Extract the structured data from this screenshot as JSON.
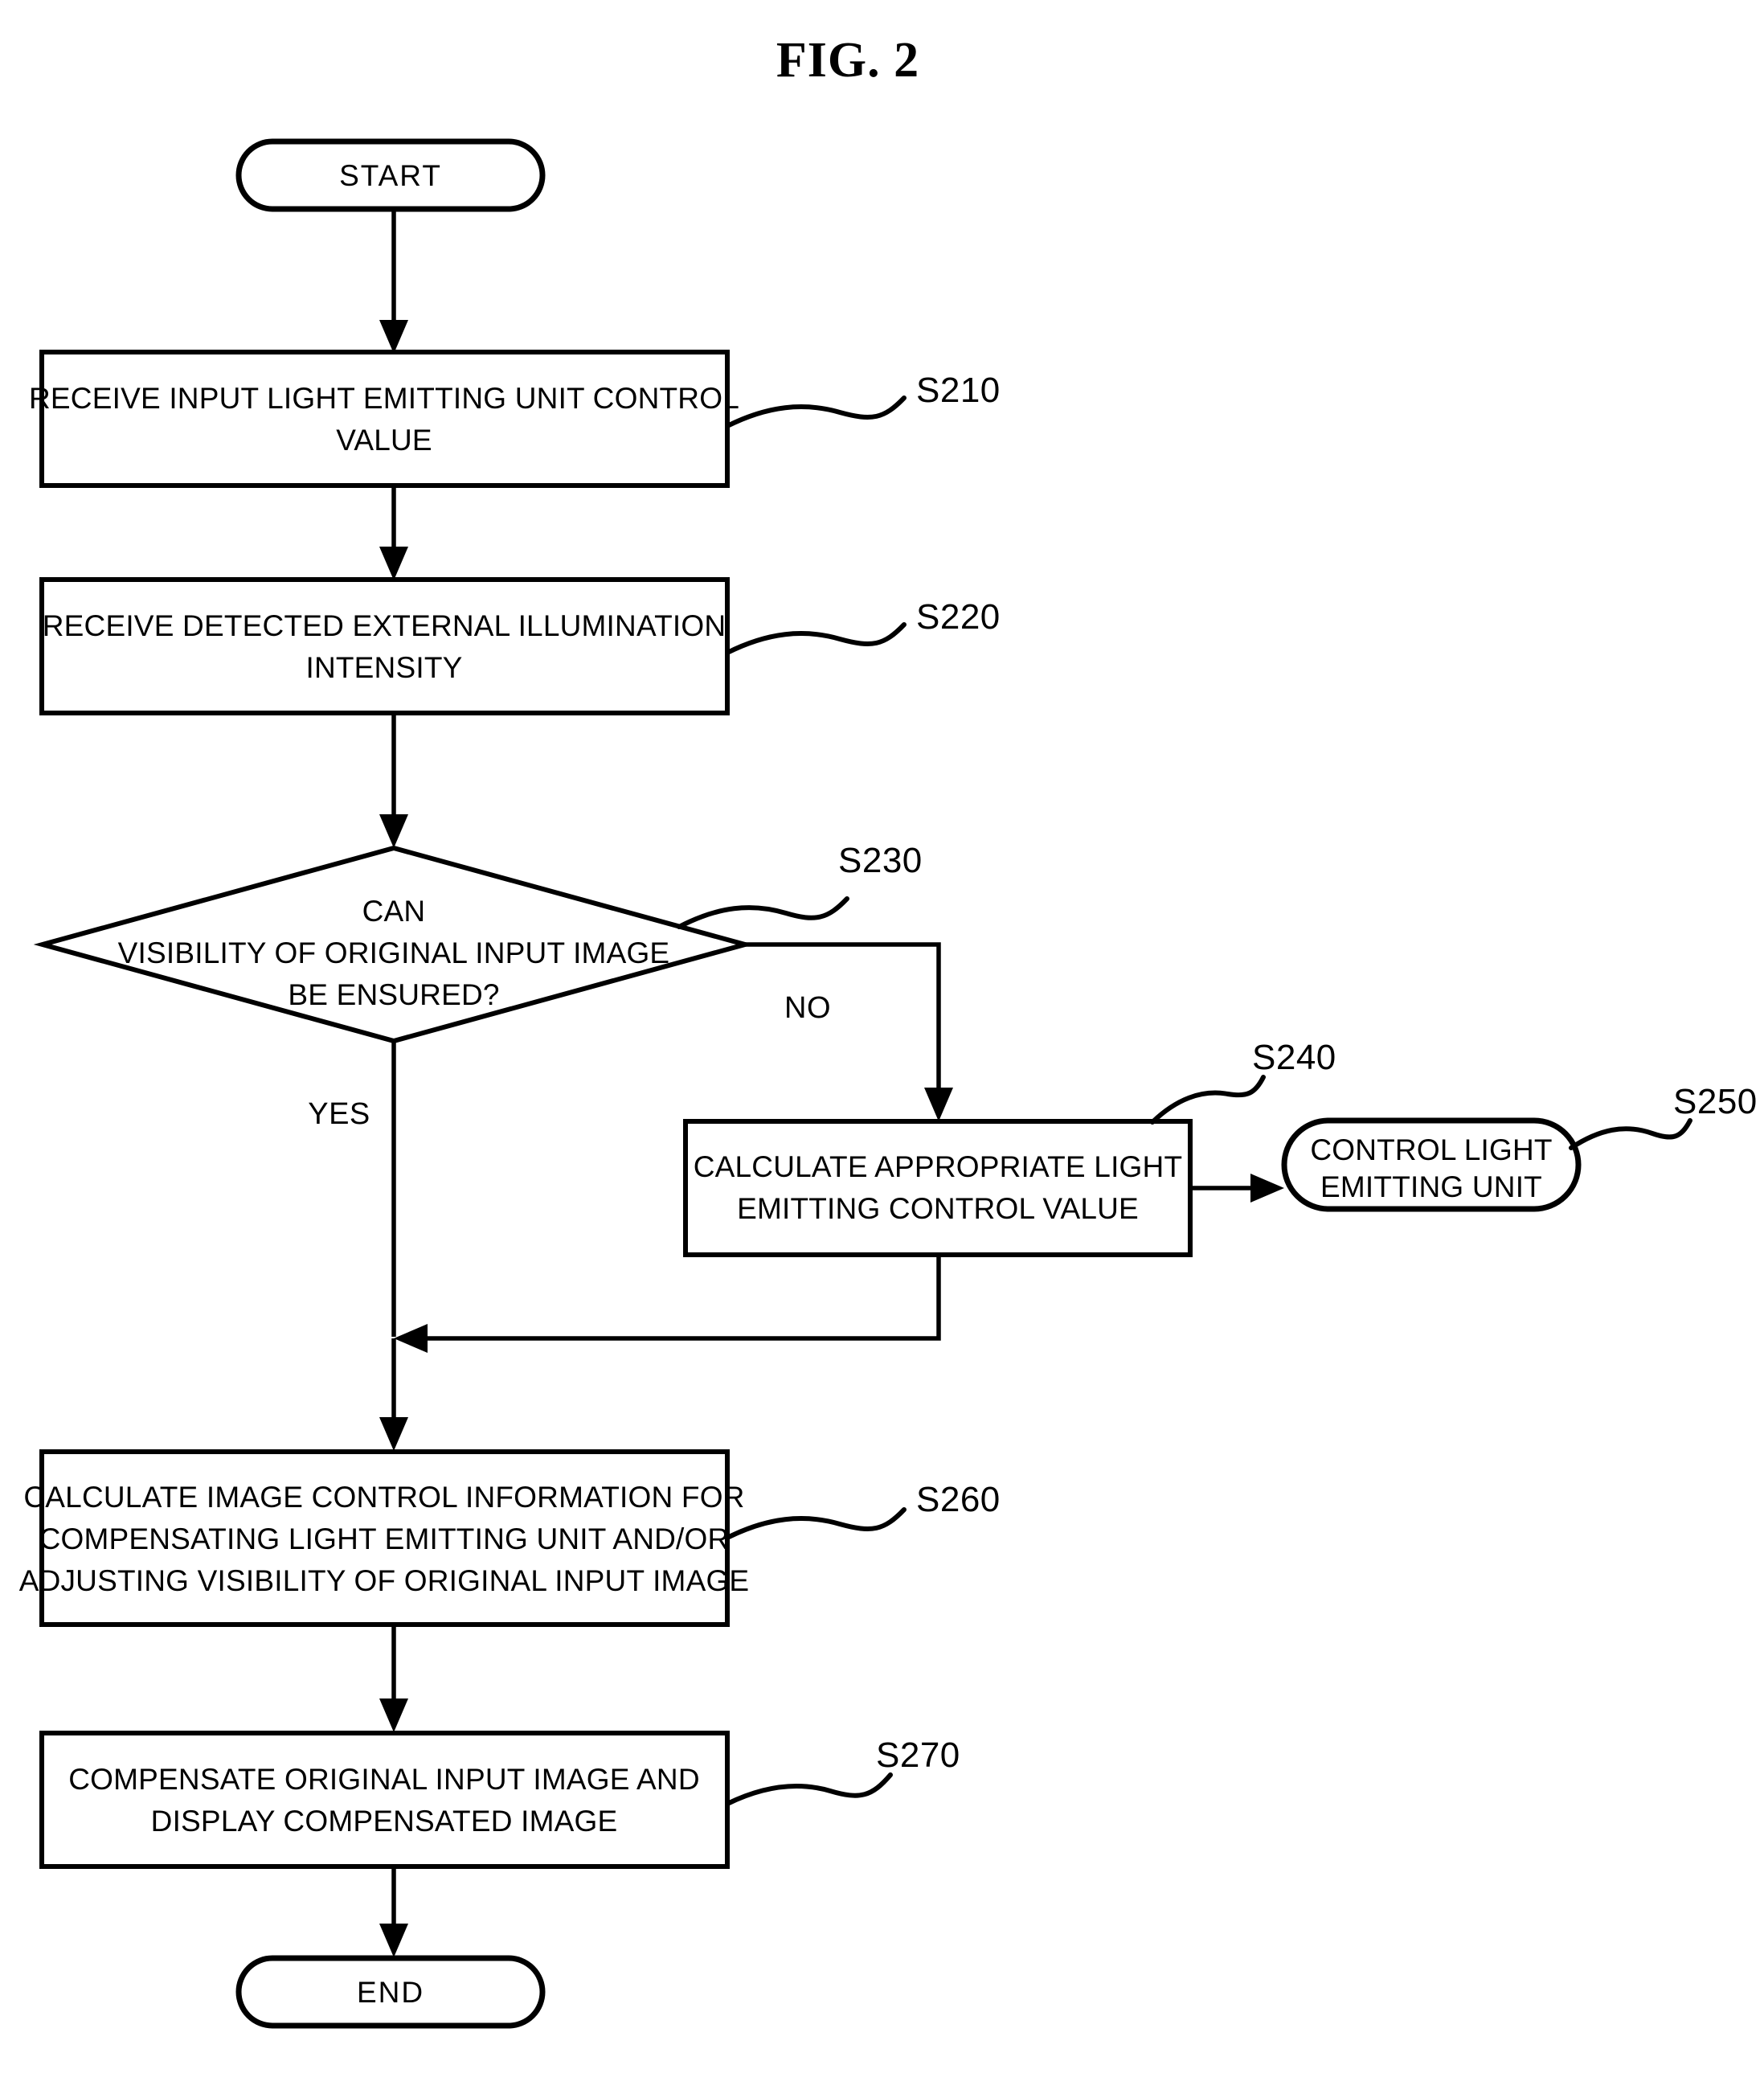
{
  "figure": {
    "title": "FIG. 2",
    "type": "flowchart",
    "ink_color": "#000000",
    "background_color": "#ffffff"
  },
  "nodes": {
    "start": {
      "shape": "terminator",
      "label": "START"
    },
    "s210": {
      "shape": "process",
      "ref": "S210",
      "lines": [
        "RECEIVE INPUT LIGHT EMITTING UNIT CONTROL",
        "VALUE"
      ]
    },
    "s220": {
      "shape": "process",
      "ref": "S220",
      "lines": [
        "RECEIVE DETECTED EXTERNAL ILLUMINATION",
        "INTENSITY"
      ]
    },
    "s230": {
      "shape": "decision",
      "ref": "S230",
      "lines": [
        "CAN",
        "VISIBILITY OF ORIGINAL INPUT IMAGE",
        "BE ENSURED?"
      ]
    },
    "s240": {
      "shape": "process",
      "ref": "S240",
      "lines": [
        "CALCULATE APPROPRIATE LIGHT",
        "EMITTING CONTROL VALUE"
      ]
    },
    "s250": {
      "shape": "terminator",
      "ref": "S250",
      "lines": [
        "CONTROL LIGHT",
        "EMITTING UNIT"
      ]
    },
    "s260": {
      "shape": "process",
      "ref": "S260",
      "lines": [
        "CALCULATE IMAGE CONTROL INFORMATION FOR",
        "COMPENSATING LIGHT EMITTING UNIT AND/OR",
        "ADJUSTING VISIBILITY OF ORIGINAL INPUT IMAGE"
      ]
    },
    "s270": {
      "shape": "process",
      "ref": "S270",
      "lines": [
        "COMPENSATE ORIGINAL INPUT IMAGE AND",
        "DISPLAY COMPENSATED IMAGE"
      ]
    },
    "end": {
      "shape": "terminator",
      "label": "END"
    }
  },
  "branches": {
    "yes": "YES",
    "no": "NO"
  }
}
